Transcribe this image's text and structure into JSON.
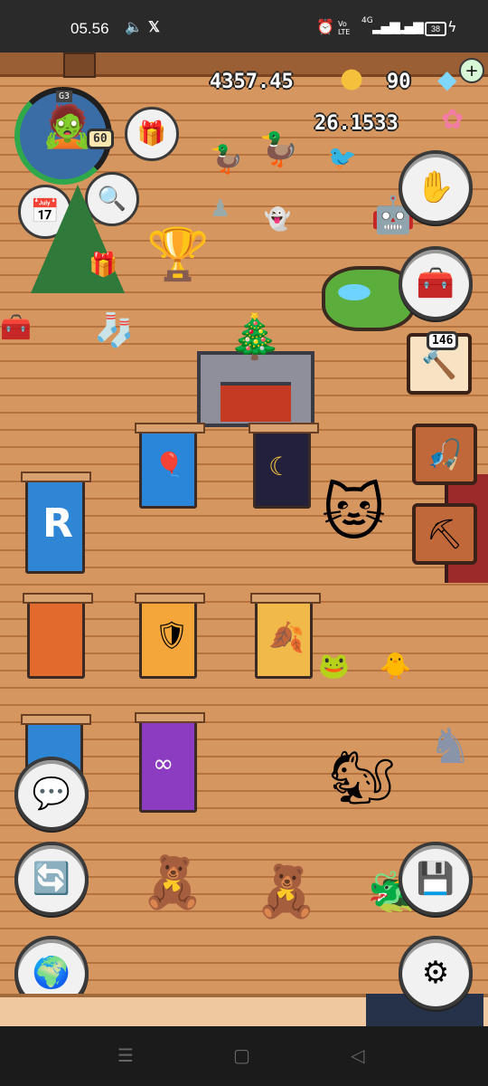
{
  "status_bar": {
    "time": "05.56",
    "volte": "Vo\nLTE",
    "network": "4G",
    "battery": "38"
  },
  "hud": {
    "coins": "4357.45",
    "gems": "90",
    "flower_currency": "26.1533",
    "level": "60",
    "player_tag": "G3",
    "item_count": "146"
  },
  "colors": {
    "floor": "#d69660",
    "floor_line": "#b6723f",
    "button_bg": "#f1f1f1",
    "tool_slot": "#c0683a"
  },
  "icons": {
    "add_gems": "plus-icon",
    "glove": "glove-icon",
    "toolbox": "toolbox-icon",
    "fishing_rod": "fishing-rod-icon",
    "pickaxe": "pickaxe-icon",
    "chat": "chat-icon",
    "swap": "swap-icon",
    "world": "globe-icon",
    "save": "floppy-disk-icon",
    "settings": "gear-icon",
    "gift": "gift-icon",
    "calendar": "calendar-icon",
    "search": "magnifier-icon"
  }
}
